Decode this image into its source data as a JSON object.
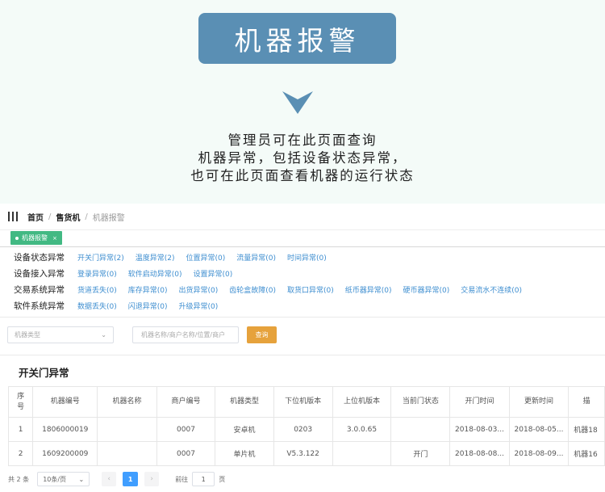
{
  "hero": {
    "title": "机器报警",
    "desc": [
      "管理员可在此页面查询",
      "机器异常，包括设备状态异常，",
      "也可在此页面查看机器的运行状态"
    ],
    "accent": "#5a8fb4"
  },
  "breadcrumb": [
    "首页",
    "售货机",
    "机器报警"
  ],
  "tab": {
    "label": "机器报警",
    "close": "×",
    "color": "#42b983"
  },
  "categories": [
    {
      "label": "设备状态异常",
      "links": [
        "开关门异常(2)",
        "温度异常(2)",
        "位置异常(0)",
        "流量异常(0)",
        "时间异常(0)"
      ]
    },
    {
      "label": "设备接入异常",
      "links": [
        "登录异常(0)",
        "软件启动异常(0)",
        "设置异常(0)"
      ]
    },
    {
      "label": "交易系统异常",
      "links": [
        "货道丢失(0)",
        "库存异常(0)",
        "出货异常(0)",
        "齿轮盒故障(0)",
        "取货口异常(0)",
        "纸币器异常(0)",
        "硬币器异常(0)",
        "交易流水不连续(0)"
      ]
    },
    {
      "label": "软件系统异常",
      "links": [
        "数据丢失(0)",
        "闪退异常(0)",
        "升级异常(0)"
      ]
    }
  ],
  "filters": {
    "type_placeholder": "机器类型",
    "search_placeholder": "机器名称/商户名称/位置/商户",
    "query_label": "查询",
    "query_color": "#e6a23c"
  },
  "section_title": "开关门异常",
  "table": {
    "columns": [
      "序号",
      "机器编号",
      "机器名称",
      "商户编号",
      "机器类型",
      "下位机版本",
      "上位机版本",
      "当前门状态",
      "开门时间",
      "更新时间",
      "描"
    ],
    "rows": [
      [
        "1",
        "1806000019",
        "",
        "0007",
        "安卓机",
        "0203",
        "3.0.0.65",
        "",
        "2018-08-03...",
        "2018-08-05...",
        "机器18"
      ],
      [
        "2",
        "1609200009",
        "",
        "0007",
        "单片机",
        "V5.3.122",
        "",
        "开门",
        "2018-08-08...",
        "2018-08-09...",
        "机器16"
      ]
    ]
  },
  "pager": {
    "total": "共 2 条",
    "page_size": "10条/页",
    "prev": "‹",
    "next": "›",
    "current": "1",
    "goto_label": "前往",
    "goto_value": "1",
    "goto_unit": "页"
  }
}
